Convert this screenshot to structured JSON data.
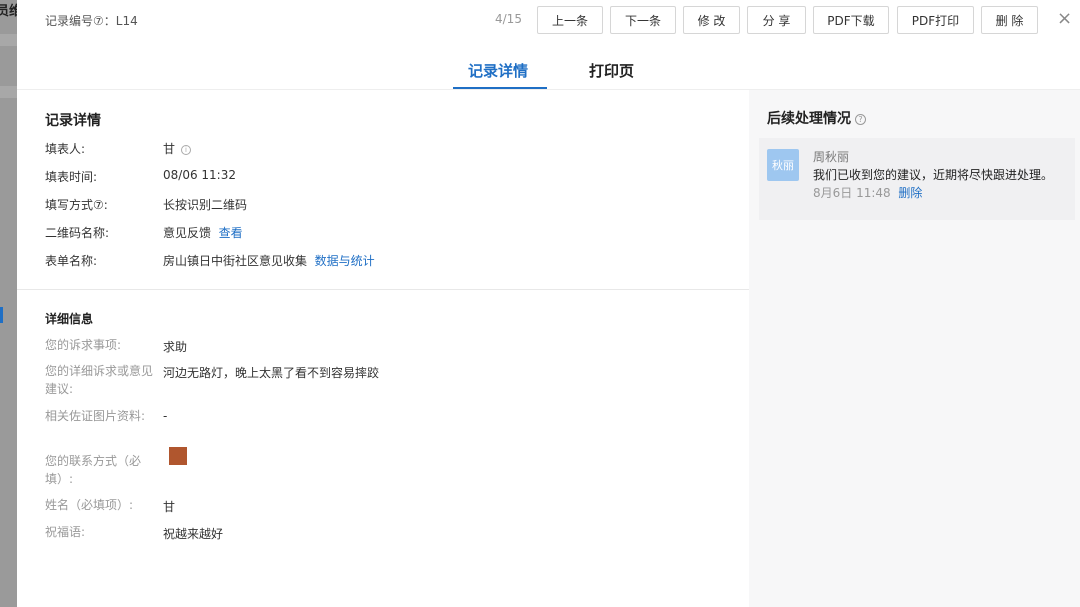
{
  "background": {
    "fragment": "员维"
  },
  "header": {
    "record_id": "记录编号⑦：L14",
    "pager": "4/15",
    "buttons": {
      "prev": "上一条",
      "next": "下一条",
      "edit": "修 改",
      "share": "分 享",
      "pdf_download": "PDF下载",
      "pdf_print": "PDF打印",
      "delete": "删 除"
    },
    "close": "×"
  },
  "tabs": [
    {
      "label": "记录详情",
      "active": true
    },
    {
      "label": "打印页",
      "active": false
    }
  ],
  "record": {
    "title": "记录详情",
    "filler_label": "填表人:",
    "filler_value": "甘",
    "time_label": "填表时间:",
    "time_value": "08/06 11:32",
    "method_label": "填写方式⑦:",
    "method_value": "长按识别二维码",
    "qr_label": "二维码名称:",
    "qr_value": "意见反馈",
    "qr_link": "查看",
    "form_label": "表单名称:",
    "form_value": "房山镇日中街社区意见收集",
    "form_link": "数据与统计"
  },
  "detail": {
    "title": "详细信息",
    "items": [
      {
        "label": "您的诉求事项:",
        "value": "求助"
      },
      {
        "label": "您的详细诉求或意见建议:",
        "value": "河边无路灯，晚上太黑了看不到容易摔跤"
      },
      {
        "label": "相关佐证图片资料:",
        "value": "-"
      },
      {
        "label": "您的联系方式（必填）:",
        "value": ""
      },
      {
        "label": "姓名（必填项）:",
        "value": "甘"
      },
      {
        "label": "祝福语:",
        "value": "祝越来越好"
      }
    ],
    "contact_swatch_color": "#b0562e"
  },
  "followup": {
    "title": "后续处理情况",
    "comment": {
      "avatar_text": "秋丽",
      "name": "周秋丽",
      "message": "我们已收到您的建议，近期将尽快跟进处理。",
      "time": "8月6日 11:48",
      "delete_label": "删除"
    }
  },
  "colors": {
    "accent": "#1f6fc5",
    "avatar": "#9ec7f0",
    "right_bg": "#f7f7f8"
  }
}
